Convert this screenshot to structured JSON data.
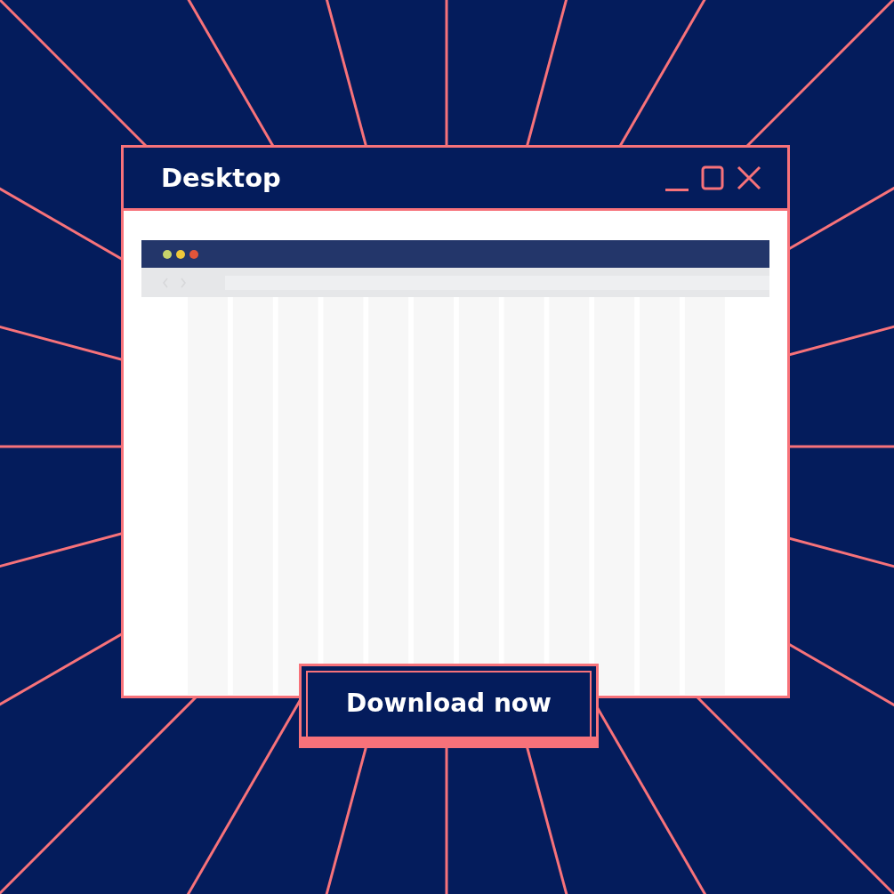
{
  "window": {
    "title": "Desktop"
  },
  "button": {
    "label": "Download now"
  }
}
